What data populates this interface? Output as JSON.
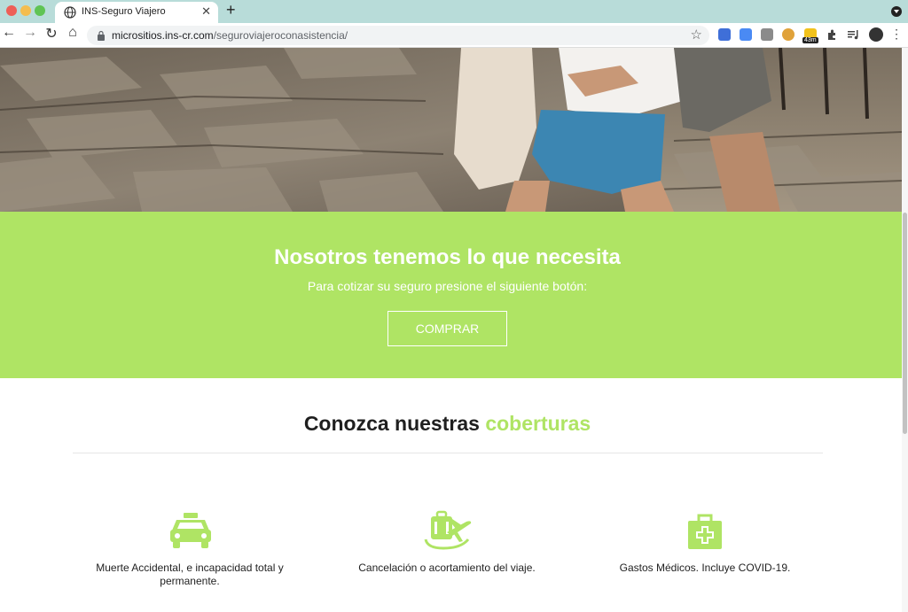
{
  "browser": {
    "tab_title": "INS-Seguro Viajero",
    "url_host": "micrositios.ins-cr.com",
    "url_path": "/seguroviajeroconasistencia/",
    "extension_badge": "43m",
    "icons": [
      "globe-icon",
      "close-icon",
      "new-tab-icon",
      "back-icon",
      "forward-icon",
      "reload-icon",
      "home-icon",
      "lock-icon",
      "star-icon",
      "extensions-icon",
      "menu-icon"
    ]
  },
  "cta": {
    "title": "Nosotros tenemos lo que necesita",
    "subtitle": "Para cotizar su seguro presione el siguiente botón:",
    "button_label": "COMPRAR"
  },
  "coverage": {
    "title_prefix": "Conozca nuestras",
    "title_accent": "coberturas",
    "items": [
      {
        "icon": "taxi-icon",
        "label": "Muerte Accidental, e incapacidad total y permanente."
      },
      {
        "icon": "luggage-plane-icon",
        "label": "Cancelación o acortamiento del viaje."
      },
      {
        "icon": "medical-kit-icon",
        "label": "Gastos Médicos. Incluye COVID-19."
      }
    ]
  },
  "colors": {
    "brand_green": "#afe464",
    "tab_bar": "#b8dcd9"
  }
}
